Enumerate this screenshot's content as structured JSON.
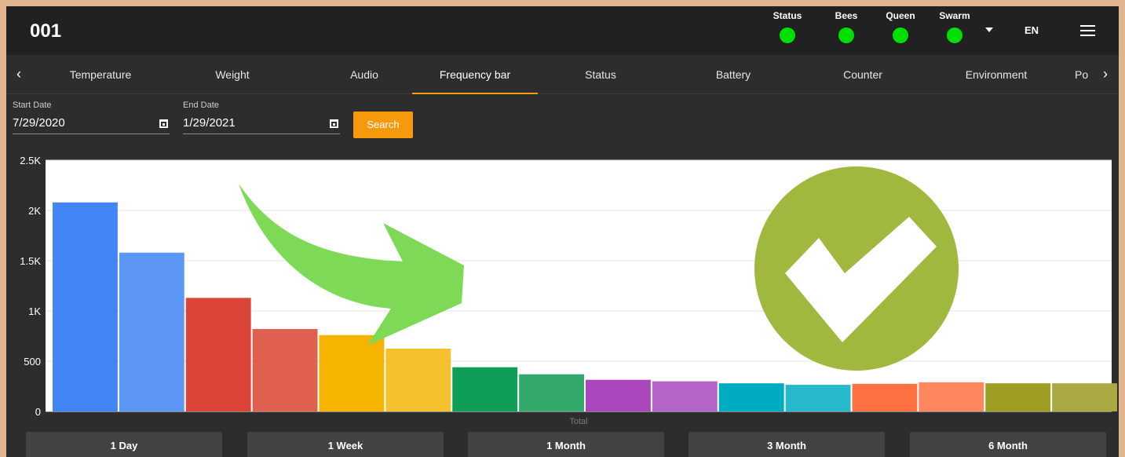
{
  "header": {
    "device_title": "001",
    "indicators": [
      {
        "label": "Status",
        "color": "#00e000"
      },
      {
        "label": "Bees",
        "color": "#00e000"
      },
      {
        "label": "Queen",
        "color": "#00e000"
      },
      {
        "label": "Swarm",
        "color": "#00e000"
      }
    ],
    "language": "EN",
    "icons": {
      "menu": "menu-icon",
      "dropdown": "chevron-down-icon"
    }
  },
  "tabs": {
    "items": [
      "Temperature",
      "Weight",
      "Audio",
      "Frequency bar",
      "Status",
      "Battery",
      "Counter",
      "Environment",
      "Po"
    ],
    "active": "Frequency bar",
    "accent": "#f39c12",
    "prev_icon": "‹",
    "next_icon": "›"
  },
  "filters": {
    "start_label": "Start Date",
    "start_value": "7/29/2020",
    "end_label": "End Date",
    "end_value": "1/29/2021",
    "search_label": "Search",
    "search_color": "#f7990c"
  },
  "range_buttons": [
    "1 Day",
    "1 Week",
    "1 Month",
    "3 Month",
    "6 Month"
  ],
  "chart_data": {
    "type": "bar",
    "xlabel": "Total",
    "ylabel": "",
    "ylim": [
      0,
      2500
    ],
    "yticks": [
      0,
      500,
      1000,
      1500,
      2000,
      2500
    ],
    "ytick_labels": [
      "0",
      "500",
      "1K",
      "1.5K",
      "2K",
      "2.5K"
    ],
    "grid": true,
    "values": [
      2080,
      1580,
      1130,
      820,
      760,
      625,
      440,
      370,
      315,
      300,
      280,
      265,
      275,
      290,
      280,
      280
    ],
    "colors": [
      "#4285f4",
      "#5c97f5",
      "#db4437",
      "#e0604f",
      "#f4b400",
      "#f5c02e",
      "#0f9d58",
      "#33aa6c",
      "#ab47bc",
      "#b565c8",
      "#00acc1",
      "#26b8cb",
      "#ff7043",
      "#ff875f",
      "#9e9d24",
      "#aaaa44"
    ]
  },
  "overlays": {
    "arrow_color": "#7ed957",
    "badge_color": "#9fb83d",
    "badge_icon": "checkmark-icon"
  }
}
